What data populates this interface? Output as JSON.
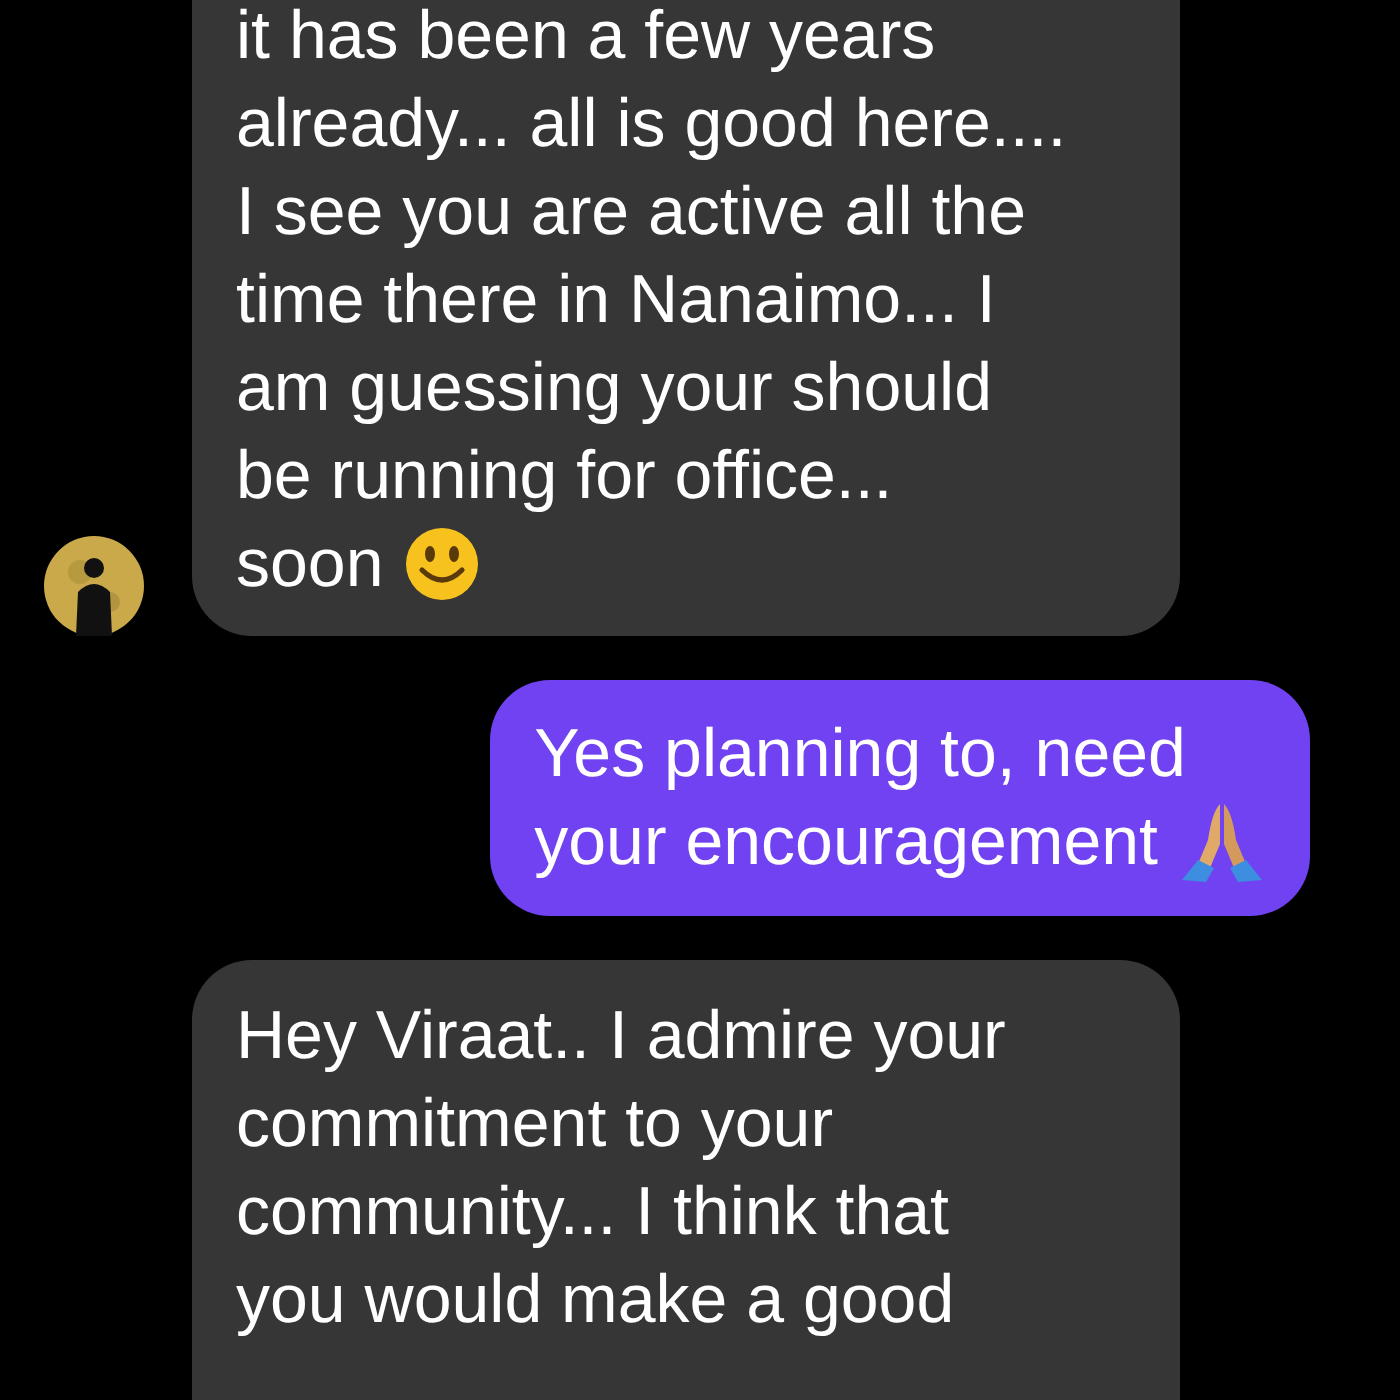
{
  "messages": [
    {
      "kind": "received",
      "lines": [
        "it has been a few years",
        "already... all is good here....",
        "I see you are active all the",
        "time there in Nanaimo... I",
        "am guessing your should",
        "be running for office...",
        "soon"
      ]
    },
    {
      "kind": "sent",
      "lines": [
        "Yes planning to, need",
        "your encouragement"
      ]
    },
    {
      "kind": "received",
      "lines": [
        "Hey Viraat.. I admire your",
        "commitment to your",
        "community... I think that",
        "you would make a good"
      ]
    }
  ]
}
